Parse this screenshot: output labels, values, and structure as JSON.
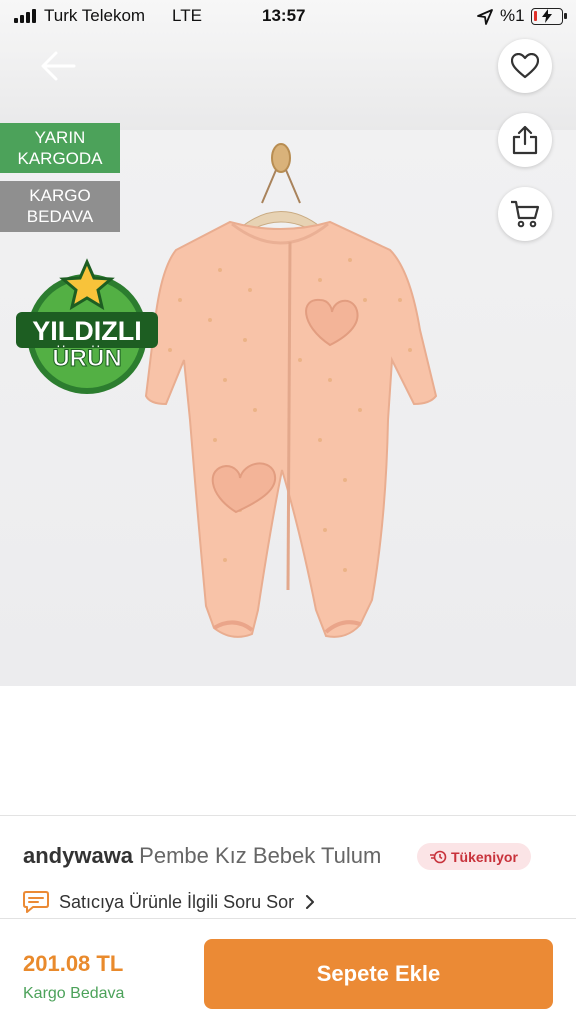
{
  "status_bar": {
    "carrier": "Turk Telekom",
    "network": "LTE",
    "time": "13:57",
    "battery_percent": "%1"
  },
  "badges": {
    "fast_line1": "YARIN",
    "fast_line2": "KARGODA",
    "free_line1": "KARGO",
    "free_line2": "BEDAVA",
    "star_line1": "YILDIZLI",
    "star_line2": "ÜRÜN"
  },
  "product": {
    "brand": "andywawa",
    "name": "Pembe Kız Bebek Tulum",
    "stock_label": "Tükeniyor",
    "ask_label": "Satıcıya Ürünle İlgili Soru Sor"
  },
  "purchase": {
    "price": "201.08 TL",
    "shipping": "Kargo Bedava",
    "button_label": "Sepete Ekle"
  },
  "colors": {
    "accent": "#eb8a35",
    "green": "#4ca25a",
    "stock_red": "#c8323b"
  },
  "icons": [
    "back-arrow-icon",
    "heart-icon",
    "share-icon",
    "cart-icon",
    "chat-icon",
    "chevron-right-icon",
    "clock-icon"
  ]
}
